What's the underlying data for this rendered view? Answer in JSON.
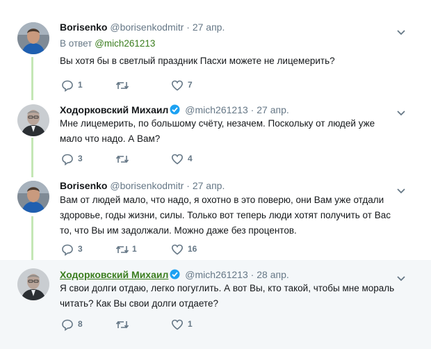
{
  "tweets": [
    {
      "name": "Borisenko",
      "handle": "@borisenkodmitr",
      "date": "27 апр.",
      "reply_prefix": "В ответ",
      "reply_to": "@mich261213",
      "text": "Вы хотя бы в светлый праздник Пасхи можете не лицемерить?",
      "replies": "1",
      "retweets": "",
      "likes": "7"
    },
    {
      "name": "Ходорковский Михаил",
      "handle": "@mich261213",
      "date": "27 апр.",
      "text": "Мне лицемерить, по большому счёту, незачем. Поскольку от людей уже\nмало что надо. А Вам?",
      "replies": "3",
      "retweets": "",
      "likes": "4"
    },
    {
      "name": "Borisenko",
      "handle": "@borisenkodmitr",
      "date": "27 апр.",
      "text": "Вам от людей мало, что надо, я охотно в это поверю, они Вам уже отдали\nздоровье, годы жизни, силы. Только вот теперь люди хотят получить от Вас\nто, что Вы им задолжали. Можно даже без процентов.",
      "replies": "3",
      "retweets": "1",
      "likes": "16"
    },
    {
      "name": "Ходорковский Михаил",
      "handle": "@mich261213",
      "date": "28 апр.",
      "text": "Я свои долги отдаю, легко погуглить. А вот Вы, кто такой, чтобы мне мораль\nчитать? Как Вы свои долги отдаете?",
      "replies": "8",
      "retweets": "",
      "likes": "1"
    }
  ],
  "icons": {
    "reply": "reply-icon",
    "retweet": "retweet-icon",
    "like": "heart-icon",
    "more": "chevron-down-icon",
    "verified": "verified-badge-icon"
  },
  "colors": {
    "thread_line": "#c4e7b5",
    "mention": "#3a7d1e",
    "verified": "#1da1f2",
    "secondary": "#657786",
    "highlight_bg": "#f4f7f9"
  }
}
